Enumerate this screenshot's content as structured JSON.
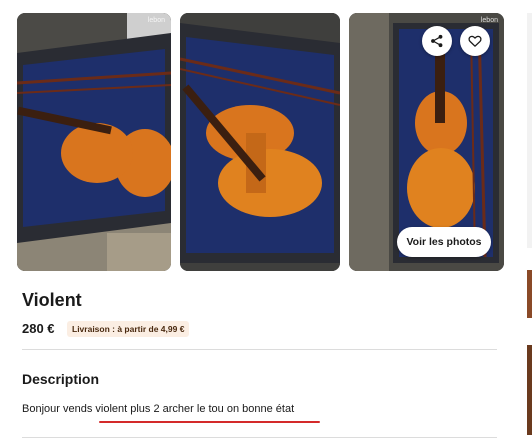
{
  "gallery": {
    "watermark": "lebon",
    "watermark_right": "lebon",
    "see_photos_label": "Voir les photos"
  },
  "listing": {
    "title": "Violent",
    "price": "280 €",
    "delivery": "Livraison : à partir de 4,99 €"
  },
  "description": {
    "heading": "Description",
    "text": "Bonjour vends violent plus 2 archer le tou on bonne état"
  },
  "colors": {
    "accent_underline": "#d42a2a",
    "delivery_badge_bg": "#fbeee3",
    "violin": "#d9751e",
    "case_lining": "#1e2f6b"
  },
  "icons": {
    "share": "share-icon",
    "favorite": "heart-icon"
  }
}
